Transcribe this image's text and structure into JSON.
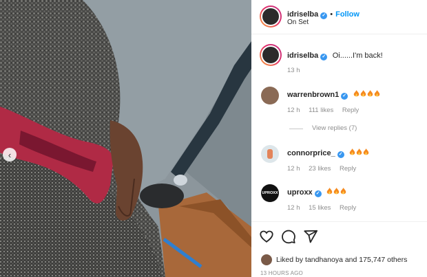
{
  "post": {
    "author": "idriselba",
    "location": "On Set",
    "follow_label": "Follow",
    "separator": "•"
  },
  "caption": {
    "username": "idriselba",
    "text": "Oi......I'm back!",
    "time": "13 h"
  },
  "comments": [
    {
      "username": "warrenbrown1",
      "flames": 4,
      "time": "12 h",
      "likes": "111 likes",
      "reply": "Reply"
    },
    {
      "username": "connorprice_",
      "flames": 3,
      "time": "12 h",
      "likes": "23 likes",
      "reply": "Reply"
    },
    {
      "username": "uproxx",
      "flames": 3,
      "time": "12 h",
      "likes": "15 likes",
      "reply": "Reply",
      "avatar_text": "UPROXX"
    }
  ],
  "view_replies": "View replies (7)",
  "likes": {
    "prefix": "Liked by",
    "user": "tandhanoya",
    "and": "and",
    "others": "175,747 others"
  },
  "timestamp": "13 HOURS AGO",
  "icons": {
    "prev": "chevron-left-icon",
    "like": "heart-icon",
    "comment": "comment-icon",
    "share": "share-icon",
    "verified": "verified-badge-icon",
    "emoji": "fire-emoji"
  },
  "colors": {
    "link": "#0095f6",
    "verified": "#3897f0",
    "muted": "#8e8e8e"
  }
}
